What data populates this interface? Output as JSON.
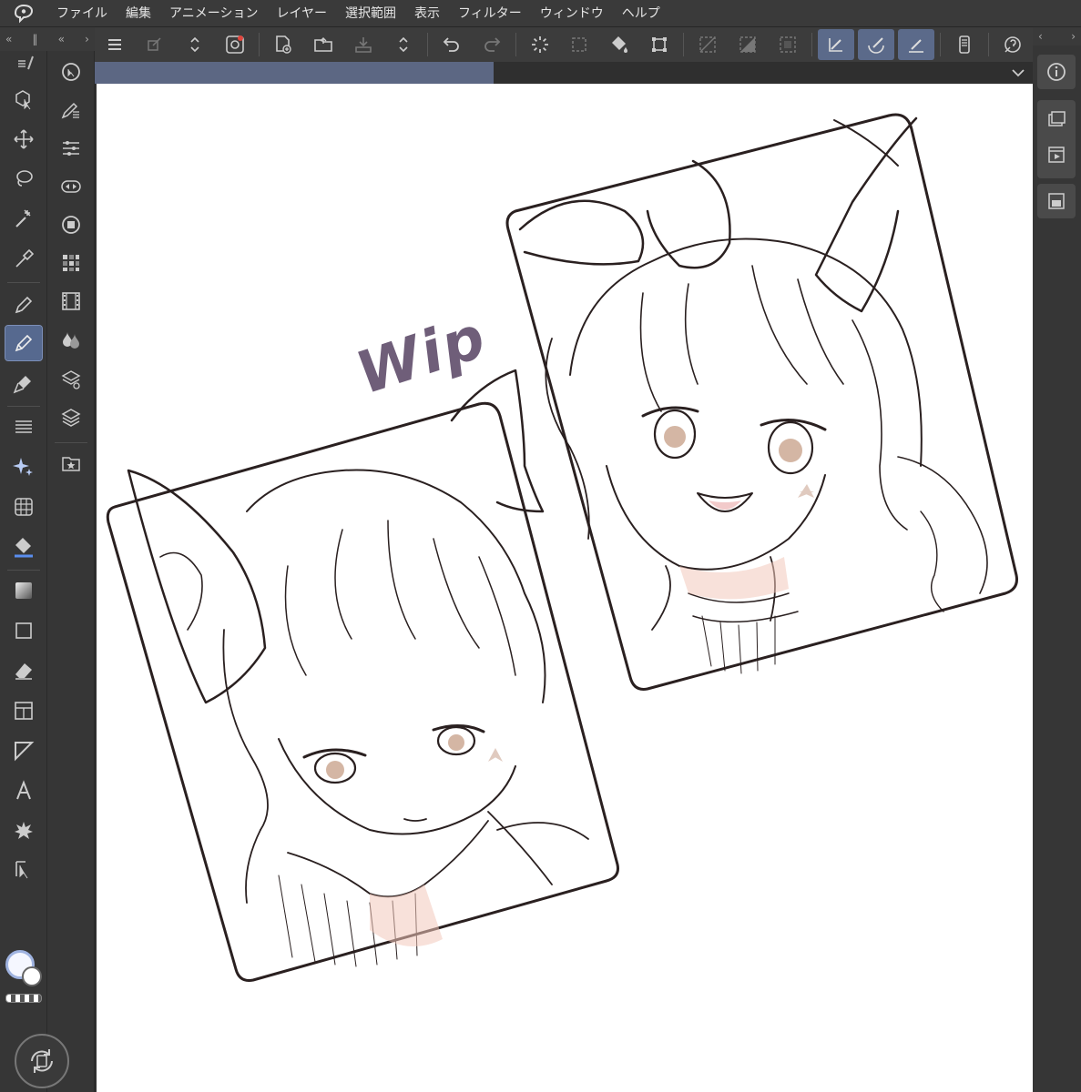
{
  "menu": {
    "items": [
      "ファイル",
      "編集",
      "アニメーション",
      "レイヤー",
      "選択範囲",
      "表示",
      "フィルター",
      "ウィンドウ",
      "ヘルプ"
    ]
  },
  "panel_arrows": {
    "left": "«",
    "right": "›",
    "right_panel_left": "‹",
    "right_panel_right": "›"
  },
  "canvas": {
    "wip_text": "Wip"
  },
  "colors": {
    "accent": "#5c6783",
    "active_tool": "#56698f",
    "wip_ink": "#6f5e79",
    "line_ink": "#2a2020"
  },
  "tools_col1": [
    "operation-icon",
    "move-icon",
    "lasso-select-icon",
    "magic-wand-icon",
    "eyedropper-icon",
    "pen-icon",
    "pencil-icon",
    "brush-icon",
    "decoration-icon",
    "airbrush-icon",
    "fill-icon",
    "gradient-icon",
    "figure-icon",
    "eraser-icon",
    "frame-border-icon",
    "ruler-icon",
    "text-icon",
    "balloon-icon",
    "correct-line-icon"
  ],
  "tools_col2": [
    "navigator-icon",
    "sub-tool-icon",
    "tool-property-icon",
    "brush-size-icon",
    "color-wheel-icon",
    "color-set-icon",
    "timeline-icon",
    "color-mixing-icon",
    "layer-property-icon",
    "layer-icon",
    "material-icon"
  ]
}
